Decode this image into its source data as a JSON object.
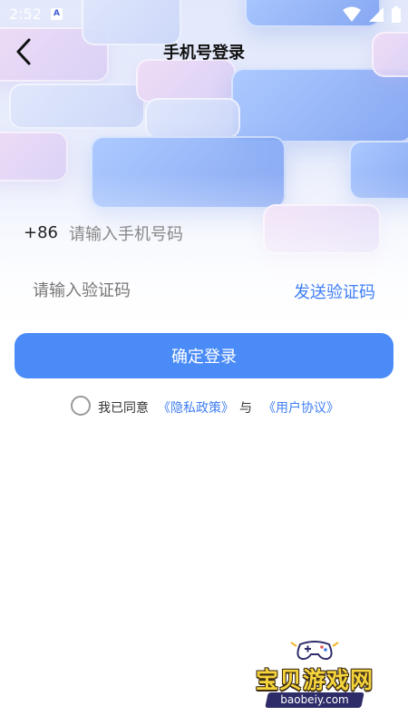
{
  "status_bar": {
    "time": "2:52",
    "notification_badge": "A",
    "icons": [
      "wifi-icon",
      "signal-icon",
      "battery-icon"
    ]
  },
  "header": {
    "back_icon": "chevron-left-icon",
    "title": "手机号登录"
  },
  "form": {
    "country_code": "+86",
    "phone_value": "",
    "phone_placeholder": "请输入手机号码",
    "code_value": "",
    "code_placeholder": "请输入验证码",
    "send_code_label": "发送验证码"
  },
  "login_button": {
    "label": "确定登录"
  },
  "agreement": {
    "checked": false,
    "prefix": "我已同意",
    "privacy_link": "《隐私政策》",
    "conjunction": "与",
    "terms_link": "《用户协议》"
  },
  "watermark": {
    "title": "宝贝游戏网",
    "url": "baobeiy.com",
    "icon": "gamepad-icon"
  },
  "colors": {
    "accent": "#4a8bf7",
    "link": "#3f7ef5",
    "title_text": "#111111",
    "placeholder": "#888888"
  }
}
